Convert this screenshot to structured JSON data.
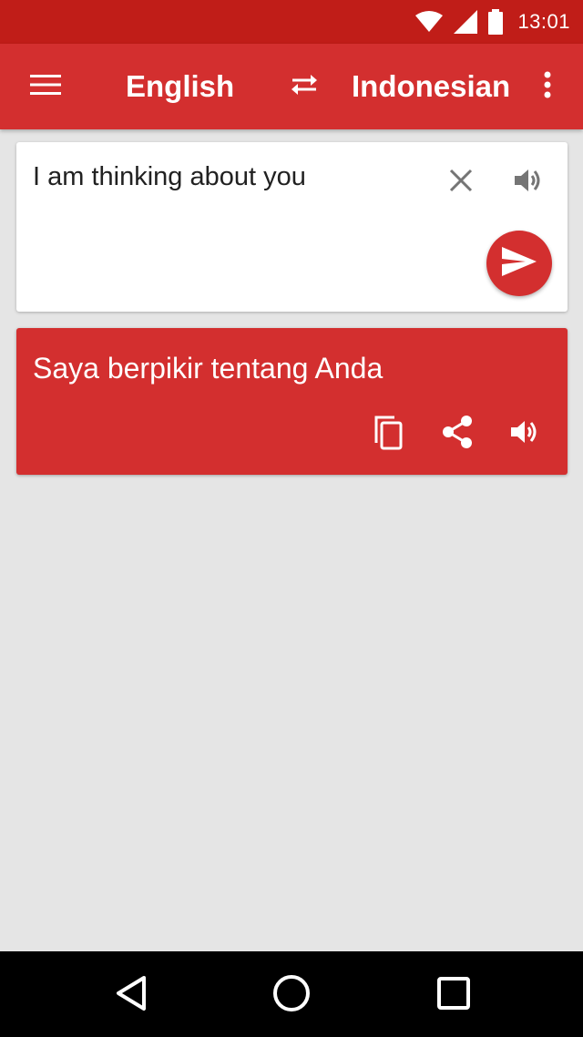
{
  "status_bar": {
    "time": "13:01",
    "icons": [
      "wifi-icon",
      "cell-signal-icon",
      "battery-icon"
    ]
  },
  "app_bar": {
    "source_language": "English",
    "target_language": "Indonesian",
    "icons": [
      "menu-icon",
      "swap-icon",
      "overflow-icon"
    ]
  },
  "input": {
    "text": "I am thinking about you",
    "icons": [
      "close-icon",
      "volume-icon",
      "send-icon"
    ]
  },
  "result": {
    "text": "Saya berpikir tentang Anda",
    "icons": [
      "copy-icon",
      "share-icon",
      "volume-icon"
    ]
  },
  "nav_bar": {
    "icons": [
      "back-icon",
      "home-icon",
      "recents-icon"
    ]
  },
  "colors": {
    "status_bar": "#c01d18",
    "primary": "#d32f2f",
    "background": "#e5e5e5",
    "card": "#ffffff",
    "icon_gray": "#757575",
    "text_dark": "#212121"
  }
}
